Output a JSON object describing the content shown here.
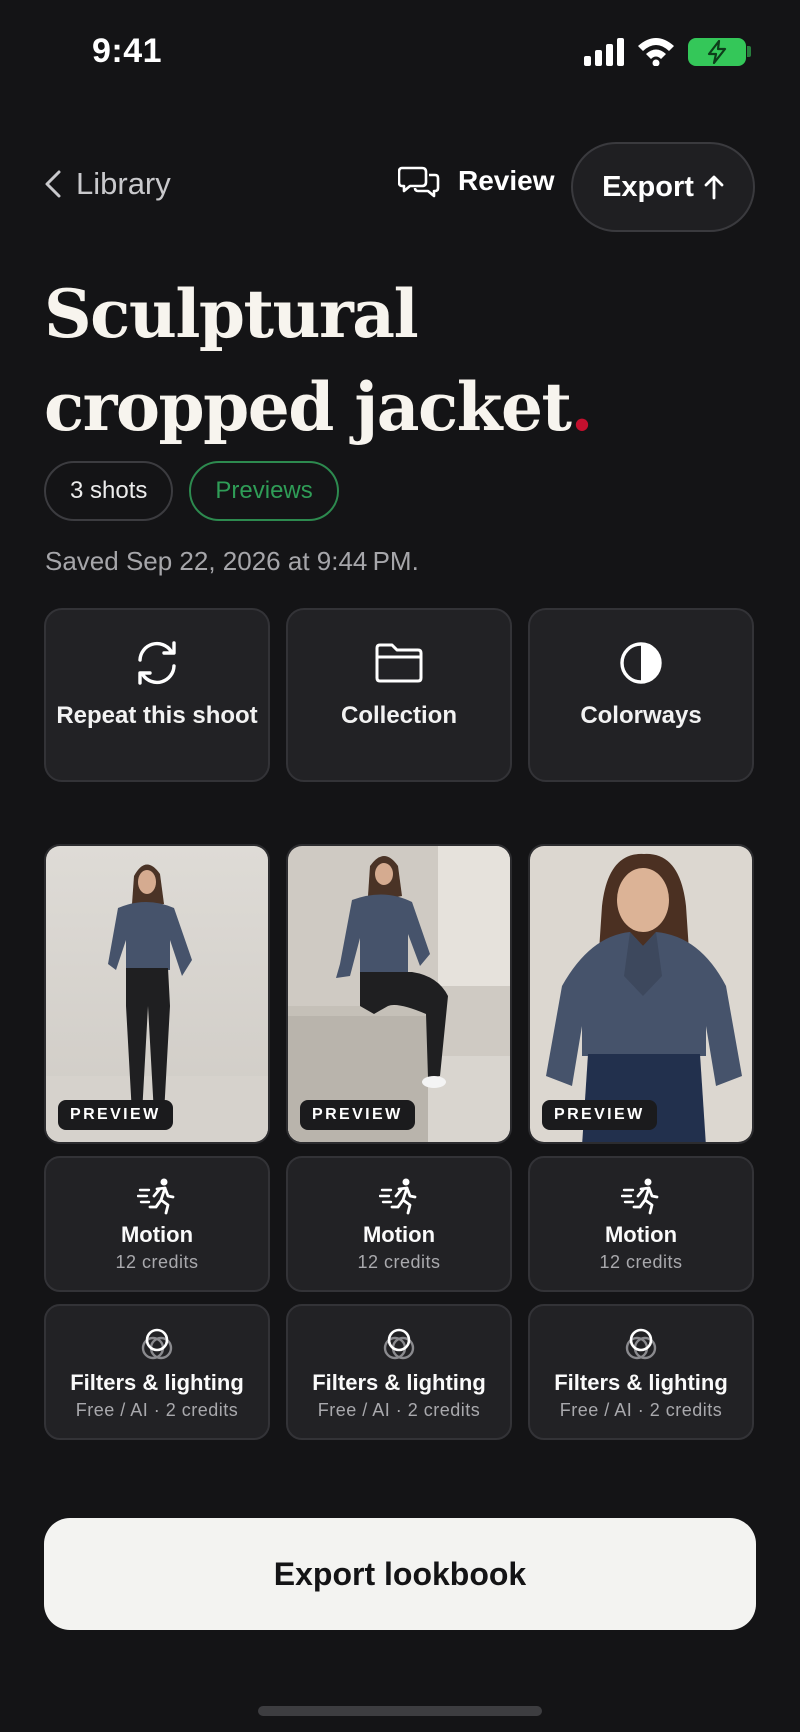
{
  "status": {
    "time": "9:41"
  },
  "nav": {
    "back_label": "Library",
    "review_label": "Review",
    "export_label": "Export"
  },
  "title": {
    "line1": "Sculptural",
    "line2": "cropped jacket",
    "dot": "."
  },
  "chips": {
    "shots": "3 shots",
    "previews": "Previews"
  },
  "saved": "Saved Sep 22, 2026 at 9:44 PM.",
  "actions": [
    {
      "label": "Repeat this shoot",
      "icon": "refresh-icon"
    },
    {
      "label": "Collection",
      "icon": "folder-icon"
    },
    {
      "label": "Colorways",
      "icon": "half-circle-icon"
    }
  ],
  "photos": [
    {
      "badge": "PREVIEW",
      "description_icon": "model-standing-full"
    },
    {
      "badge": "PREVIEW",
      "description_icon": "model-seated"
    },
    {
      "badge": "PREVIEW",
      "description_icon": "model-closeup"
    }
  ],
  "motion": [
    {
      "name": "Motion",
      "sub": "12 credits"
    },
    {
      "name": "Motion",
      "sub": "12 credits"
    },
    {
      "name": "Motion",
      "sub": "12 credits"
    }
  ],
  "filters": [
    {
      "name": "Filters & lighting",
      "sub": "Free / AI · 2 credits"
    },
    {
      "name": "Filters & lighting",
      "sub": "Free / AI · 2 credits"
    },
    {
      "name": "Filters & lighting",
      "sub": "Free / AI · 2 credits"
    }
  ],
  "cta": {
    "label": "Export lookbook"
  },
  "colors": {
    "accent_green": "#2f9d57",
    "title_dot": "#c4102e",
    "battery": "#34c759",
    "background": "#141416"
  }
}
